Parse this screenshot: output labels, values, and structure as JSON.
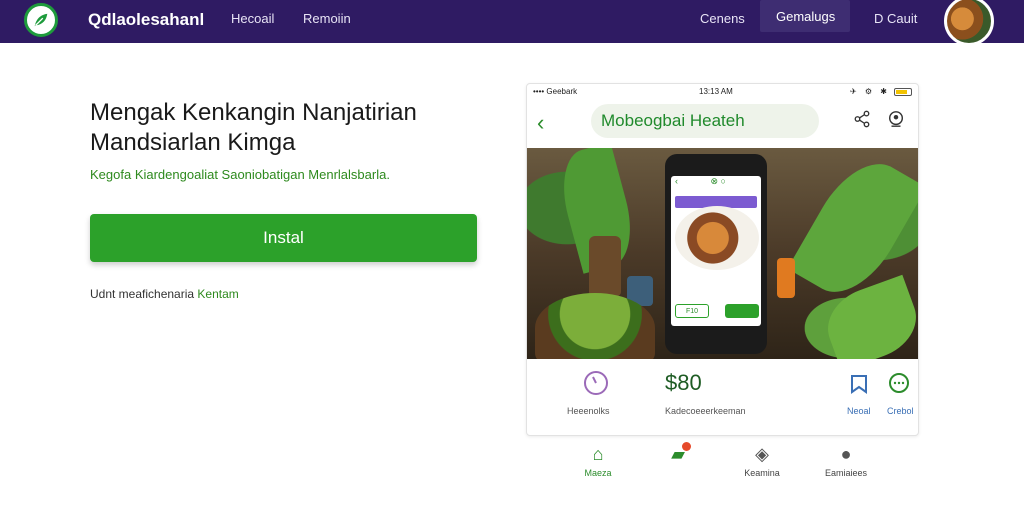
{
  "navbar": {
    "brand": "Qdlaolesahanl",
    "links": [
      "Hecoail",
      "Remoiin"
    ],
    "right_links": [
      "Cenens",
      "Gemalugs",
      "D Cauit"
    ],
    "brand_color": "#2f1b63",
    "logo_icon": "leaf-icon"
  },
  "hero": {
    "title": "Mengak Kenkangin Nanjatirian Mandsiarlan Kimga",
    "subtitle": "Kegofa Kiardengoaliat Saoniobatigan Menrlalsbarla.",
    "install_label": "Instal",
    "foot_prefix": "Udnt meafichenaria",
    "foot_link": "Kentam",
    "accent": "#2ca12a"
  },
  "phone": {
    "status_left": "•••• Geebark ",
    "status_time": "13:13 AM",
    "status_right": "✈ ⚙ ✱",
    "header_title": "Mobeogbai Heateh",
    "inner_screen": {
      "price_tag": "F10"
    },
    "info": {
      "left_label": "Heeenolks",
      "price": "$80",
      "price_label": "Kadecoeeerkeeman",
      "right1_label": "Neoal",
      "right2_label": "Crebol"
    }
  },
  "bottom_nav": [
    {
      "label": "Maeza",
      "icon": "home-icon",
      "active": true
    },
    {
      "label": "",
      "icon": "cart-icon",
      "active": true
    },
    {
      "label": "Keamina",
      "icon": "location-icon",
      "active": false
    },
    {
      "label": "Eamiaiees",
      "icon": "person-icon",
      "active": false
    }
  ]
}
